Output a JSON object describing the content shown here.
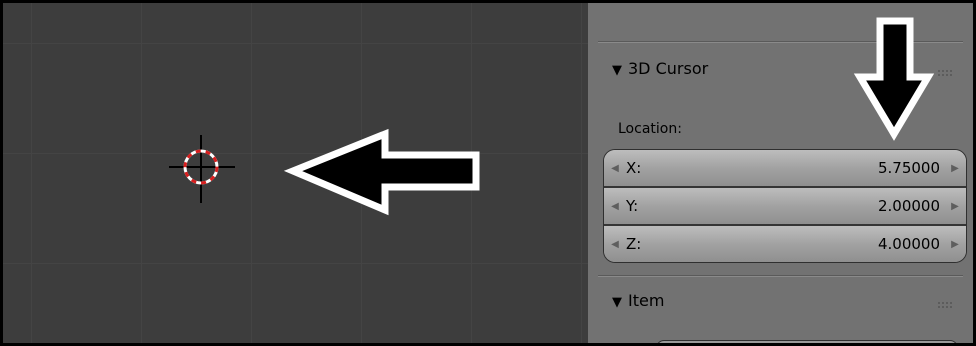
{
  "panel": {
    "cursor_section": {
      "title": "3D Cursor",
      "location_label": "Location:",
      "fields": [
        {
          "axis": "X:",
          "value": "5.75000"
        },
        {
          "axis": "Y:",
          "value": "2.00000"
        },
        {
          "axis": "Z:",
          "value": "4.00000"
        }
      ]
    },
    "item_section": {
      "title": "Item"
    }
  },
  "icons": {
    "collapse": "triangle-down-icon",
    "drag": "drag-handle-icon",
    "decrement": "arrow-left-icon",
    "increment": "arrow-right-icon",
    "cursor": "3d-cursor-icon"
  },
  "colors": {
    "viewport_bg": "#3d3d3d",
    "panel_bg": "#727272",
    "cursor_ring_red": "#d81e1e",
    "cursor_ring_white": "#ffffff",
    "annotation_arrow_fill": "#000000",
    "annotation_arrow_stroke": "#ffffff"
  }
}
